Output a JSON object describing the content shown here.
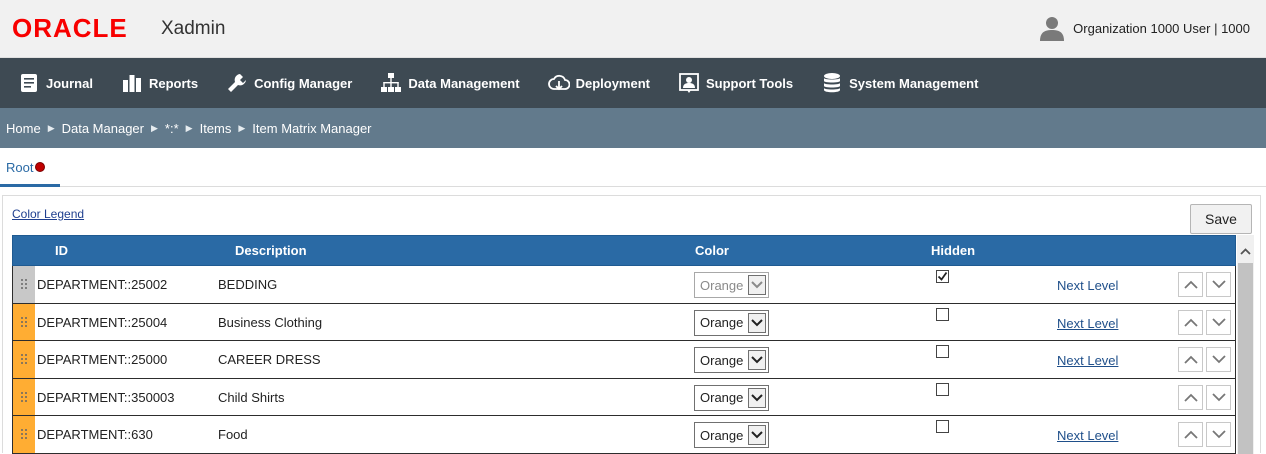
{
  "header": {
    "logo": "ORACLE",
    "app_name": "Xadmin",
    "user": "Organization 1000 User | 1000"
  },
  "nav": [
    {
      "label": "Journal",
      "icon": "journal-icon"
    },
    {
      "label": "Reports",
      "icon": "reports-icon"
    },
    {
      "label": "Config Manager",
      "icon": "wrench-icon"
    },
    {
      "label": "Data Management",
      "icon": "hierarchy-icon"
    },
    {
      "label": "Deployment",
      "icon": "cloud-download-icon"
    },
    {
      "label": "Support Tools",
      "icon": "support-icon"
    },
    {
      "label": "System Management",
      "icon": "database-icon"
    }
  ],
  "breadcrumb": [
    "Home",
    "Data Manager",
    "*:*",
    "Items",
    "Item Matrix Manager"
  ],
  "tab": {
    "label": "Root"
  },
  "panel": {
    "legend_link": "Color Legend",
    "save_label": "Save"
  },
  "grid": {
    "columns": {
      "id": "ID",
      "description": "Description",
      "color": "Color",
      "hidden": "Hidden"
    },
    "rows": [
      {
        "id": "DEPARTMENT::25002",
        "description": "BEDDING",
        "color": "Orange",
        "hidden": true,
        "next_level": "Next Level",
        "selected": true
      },
      {
        "id": "DEPARTMENT::25004",
        "description": "Business Clothing",
        "color": "Orange",
        "hidden": false,
        "next_level": "Next Level",
        "selected": false
      },
      {
        "id": "DEPARTMENT::25000",
        "description": "CAREER DRESS",
        "color": "Orange",
        "hidden": false,
        "next_level": "Next Level",
        "selected": false
      },
      {
        "id": "DEPARTMENT::350003",
        "description": "Child Shirts",
        "color": "Orange",
        "hidden": false,
        "next_level": "",
        "selected": false
      },
      {
        "id": "DEPARTMENT::630",
        "description": "Food",
        "color": "Orange",
        "hidden": false,
        "next_level": "Next Level",
        "selected": false
      }
    ]
  },
  "colors": {
    "brand_red": "#f80000",
    "nav_bg": "#3e4a53",
    "breadcrumb_bg": "#627a8c",
    "grid_header": "#2a6aa5",
    "row_handle": "#ffad33"
  }
}
